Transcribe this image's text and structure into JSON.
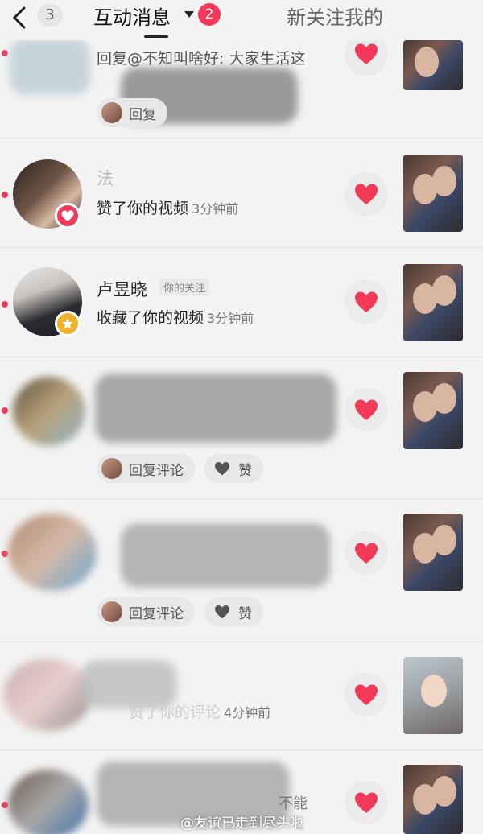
{
  "header": {
    "back_count": "3",
    "active_tab": "互动消息",
    "badge": "2",
    "other_tab": "新关注我的"
  },
  "rows": [
    {
      "text": "回复@不知叫啥好: 大家生活这",
      "reply_label": "回复"
    },
    {
      "name": "法",
      "action": "赞了你的视频",
      "time": "3分钟前"
    },
    {
      "name": "卢昱晓",
      "tag": "你的关注",
      "action": "收藏了你的视频",
      "time": "3分钟前"
    },
    {
      "reply_label": "回复评论",
      "like_label": "赞"
    },
    {
      "reply_label": "回复评论",
      "like_label": "赞"
    },
    {
      "action": "赞了你的评论",
      "time": "4分钟前"
    },
    {
      "text": "不能"
    }
  ],
  "watermark": "@友谊已走到尽头啦",
  "colors": {
    "accent": "#f2395a",
    "background": "#f3f3f3"
  }
}
